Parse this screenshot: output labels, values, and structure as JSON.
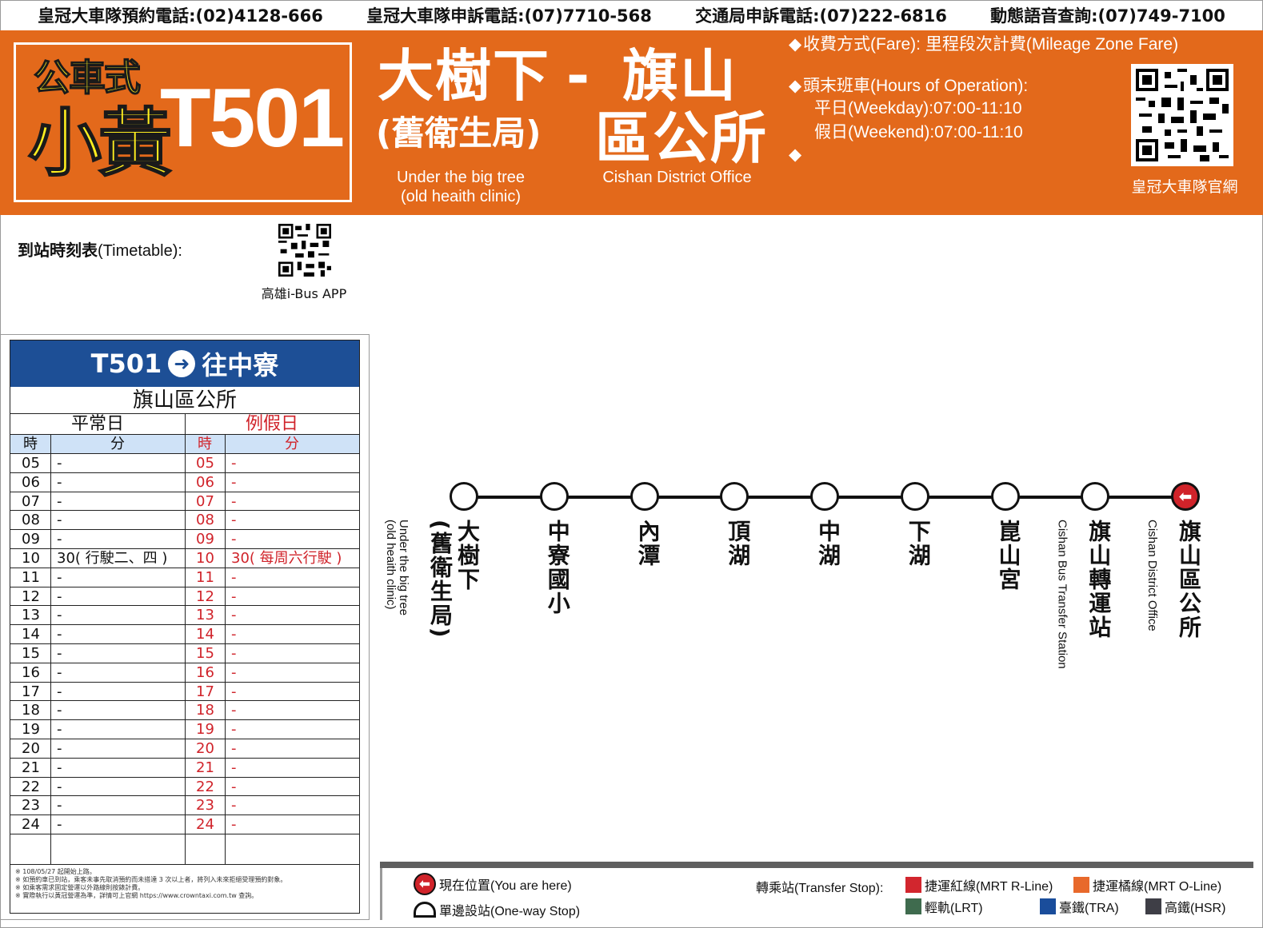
{
  "top_bar": {
    "items": [
      "皇冠大車隊預約電話:(02)4128-666",
      "皇冠大車隊申訴電話:(07)7710-568",
      "交通局申訴電話:(07)222-6816",
      "動態語音查詢:(07)749-7100"
    ]
  },
  "brand": {
    "line1": "公車式",
    "line2": "小黃",
    "route_number": "T501"
  },
  "destinations": {
    "from_name": "大樹下",
    "dash": "-",
    "from_sub": "(舊衛生局)",
    "from_en_1": "Under the big tree",
    "from_en_2": "(old heaith clinic)",
    "to_name_1": "旗山",
    "to_name_2": "區公所",
    "to_en": "Cishan District Office"
  },
  "info": {
    "fare": "收費方式(Fare): 里程段次計費(Mileage Zone Fare)",
    "hours_title": "頭末班車(Hours of Operation):",
    "weekday": "平日(Weekday):07:00-11:10",
    "weekend": "假日(Weekend):07:00-11:10",
    "qr_label": "皇冠大車隊官網",
    "bullet": "◆"
  },
  "timetable_link": {
    "label_zh": "到站時刻表",
    "label_en": "(Timetable):",
    "app_label": "高雄i-Bus APP"
  },
  "schedule": {
    "route": "T501",
    "direction": "往中寮",
    "stop": "旗山區公所",
    "weekday_label": "平常日",
    "holiday_label": "例假日",
    "hour_label": "時",
    "minute_label": "分",
    "rows": [
      {
        "hour": "05",
        "weekday": "-",
        "holiday": "-"
      },
      {
        "hour": "06",
        "weekday": "-",
        "holiday": "-"
      },
      {
        "hour": "07",
        "weekday": "-",
        "holiday": "-"
      },
      {
        "hour": "08",
        "weekday": "-",
        "holiday": "-"
      },
      {
        "hour": "09",
        "weekday": "-",
        "holiday": "-"
      },
      {
        "hour": "10",
        "weekday": "30( 行駛二、四 )",
        "holiday": "30( 每周六行駛 )"
      },
      {
        "hour": "11",
        "weekday": "-",
        "holiday": "-"
      },
      {
        "hour": "12",
        "weekday": "-",
        "holiday": "-"
      },
      {
        "hour": "13",
        "weekday": "-",
        "holiday": "-"
      },
      {
        "hour": "14",
        "weekday": "-",
        "holiday": "-"
      },
      {
        "hour": "15",
        "weekday": "-",
        "holiday": "-"
      },
      {
        "hour": "16",
        "weekday": "-",
        "holiday": "-"
      },
      {
        "hour": "17",
        "weekday": "-",
        "holiday": "-"
      },
      {
        "hour": "18",
        "weekday": "-",
        "holiday": "-"
      },
      {
        "hour": "19",
        "weekday": "-",
        "holiday": "-"
      },
      {
        "hour": "20",
        "weekday": "-",
        "holiday": "-"
      },
      {
        "hour": "21",
        "weekday": "-",
        "holiday": "-"
      },
      {
        "hour": "22",
        "weekday": "-",
        "holiday": "-"
      },
      {
        "hour": "23",
        "weekday": "-",
        "holiday": "-"
      },
      {
        "hour": "24",
        "weekday": "-",
        "holiday": "-"
      }
    ],
    "notes": [
      "※ 108/05/27 起開始上路。",
      "※ 如預約車已到站，乘客未事先取消預約而未搭達 3 次以上者，將列入未來拒絕受理預約對象。",
      "※ 如乘客需求固定營運以外路線則按錶計費。",
      "※ 實際執行以黃冠營運為準，詳情可上官網 https://www.crowntaxi.com.tw 查詢。"
    ]
  },
  "route_stops": [
    {
      "name": "大樹下",
      "sub": "(舊衛生局)",
      "en_1": "Under the big tree",
      "en_2": "(old heaith clinic)"
    },
    {
      "name": "中寮國小"
    },
    {
      "name": "內潭"
    },
    {
      "name": "頂湖"
    },
    {
      "name": "中湖"
    },
    {
      "name": "下湖"
    },
    {
      "name": "崑山宮"
    },
    {
      "name": "旗山轉運站",
      "en_1": "Cishan Bus Transfer Station"
    },
    {
      "name": "旗山區公所",
      "en_1": "Cishan District Office",
      "current": true
    }
  ],
  "legend": {
    "here": "現在位置(You are here)",
    "oneway": "單邊設站(One-way Stop)",
    "transfer": "轉乘站(Transfer Stop):",
    "mrt_r": "捷運紅線(MRT R-Line)",
    "mrt_o": "捷運橘線(MRT O-Line)",
    "lrt": "輕軌(LRT)",
    "tra": "臺鐵(TRA)",
    "hsr": "高鐵(HSR)",
    "colors": {
      "mrt_r": "#d2262e",
      "mrt_o": "#e8692b",
      "lrt": "#3f6b4e",
      "tra": "#1a4d9b",
      "hsr": "#3e3e46"
    }
  },
  "colors": {
    "header_orange": "#e3691b",
    "brand_yellow": "#ffef1f",
    "schedule_blue": "#1d4f96",
    "holiday_red": "#d0232a"
  }
}
